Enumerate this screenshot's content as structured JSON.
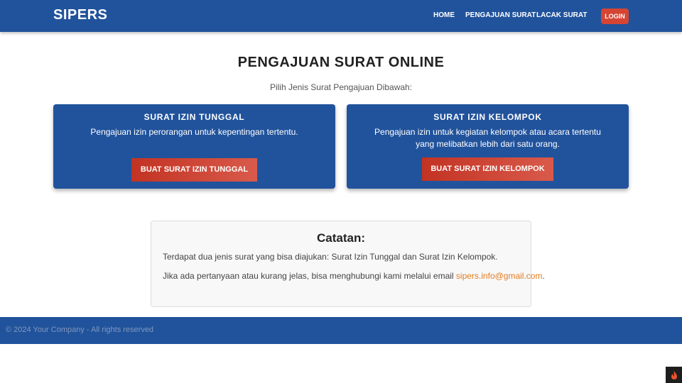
{
  "header": {
    "brand": "SIPERS",
    "nav": {
      "home": "HOME",
      "pengajuan": "PENGAJUAN SURAT",
      "lacak": "LACAK SURAT"
    },
    "login": "LOGIN"
  },
  "main": {
    "title": "PENGAJUAN SURAT ONLINE",
    "subtitle": "Pilih Jenis Surat Pengajuan Dibawah:",
    "cards": [
      {
        "title": "SURAT IZIN TUNGGAL",
        "description": "Pengajuan izin perorangan untuk kepentingan tertentu.",
        "button": "BUAT SURAT IZIN TUNGGAL"
      },
      {
        "title": "SURAT IZIN KELOMPOK",
        "description": "Pengajuan izin untuk kegiatan kelompok atau acara tertentu yang melibatkan lebih dari satu orang.",
        "button": "BUAT SURAT IZIN KELOMPOK"
      }
    ],
    "note": {
      "title": "Catatan:",
      "line1": "Terdapat dua jenis surat yang bisa diajukan: Surat Izin Tunggal dan Surat Izin Kelompok.",
      "line2_prefix": "Jika ada pertanyaan atau kurang jelas, bisa menghubungi kami melalui email ",
      "email": "sipers.info@gmail.com",
      "line2_suffix": "."
    }
  },
  "footer": {
    "text": "© 2024 Your Company - All rights reserved"
  },
  "colors": {
    "primary": "#21539c",
    "accent": "#d64533",
    "link": "#e57c1f"
  },
  "icons": {
    "corner": "flame-icon"
  }
}
